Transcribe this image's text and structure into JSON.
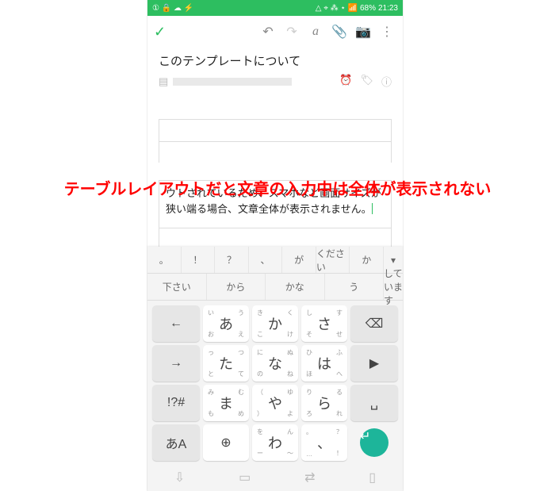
{
  "status": {
    "leftIcons": "① 🔒 ☁ ⚡",
    "rightIcons": "△ ⌖ ⁂ ⋆ 📶",
    "battery": "68%",
    "time": "21:23"
  },
  "annotation": "テーブルレイアウトだと文章の入力中は全体が表示されない",
  "title": "このテンプレートについて",
  "bodyText": "ウトされているため、スマホなど画面サイズが狭い端る場合、文章全体が表示されません。",
  "suggest1": [
    "。",
    "！",
    "？",
    "、",
    "が",
    "ください",
    "か",
    "▾"
  ],
  "suggest2": [
    "下さい",
    "から",
    "かな",
    "う",
    "しています"
  ],
  "keys": [
    [
      {
        "t": "←",
        "g": 1
      },
      {
        "m": "あ",
        "tl": "い",
        "tr": "う",
        "bl": "お",
        "br": "え"
      },
      {
        "m": "か",
        "tl": "き",
        "tr": "く",
        "bl": "こ",
        "br": "け"
      },
      {
        "m": "さ",
        "tl": "し",
        "tr": "す",
        "bl": "そ",
        "br": "せ"
      },
      {
        "t": "⌫",
        "g": 1
      }
    ],
    [
      {
        "t": "→",
        "g": 1
      },
      {
        "m": "た",
        "tl": "っ",
        "tr": "つ",
        "bl": "と",
        "br": "て"
      },
      {
        "m": "な",
        "tl": "に",
        "tr": "ぬ",
        "bl": "の",
        "br": "ね"
      },
      {
        "m": "は",
        "tl": "ひ",
        "tr": "ふ",
        "bl": "ほ",
        "br": "へ"
      },
      {
        "t": "▶",
        "g": 1
      }
    ],
    [
      {
        "t": "!?#",
        "g": 1
      },
      {
        "m": "ま",
        "tl": "み",
        "tr": "む",
        "bl": "も",
        "br": "め"
      },
      {
        "m": "や",
        "tl": "（",
        "tr": "ゆ",
        "bl": "）",
        "br": "よ"
      },
      {
        "m": "ら",
        "tl": "り",
        "tr": "る",
        "bl": "ろ",
        "br": "れ"
      },
      {
        "t": "␣",
        "g": 1
      }
    ],
    [
      {
        "t": "あA",
        "g": 1
      },
      {
        "t": "⊕",
        "g": 0
      },
      {
        "m": "わ",
        "tl": "を",
        "tr": "ん",
        "bl": "ー",
        "br": "〜"
      },
      {
        "m": "、",
        "tl": "。",
        "tr": "？",
        "bl": "…",
        "br": "！"
      },
      {
        "t": "↵",
        "enter": 1
      }
    ]
  ]
}
